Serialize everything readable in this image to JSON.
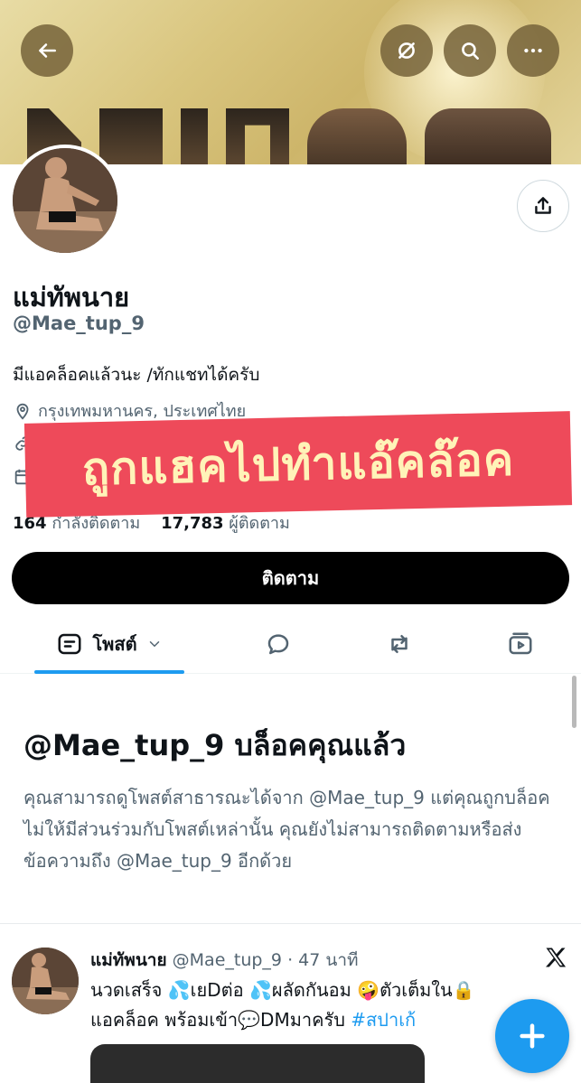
{
  "header": {
    "back_icon": "arrow-left-icon",
    "translate_icon": "no-translate-icon",
    "search_icon": "search-icon",
    "more_icon": "more-horizontal-icon"
  },
  "profile": {
    "display_name": "แม่ทัพนาย",
    "handle": "@Mae_tup_9",
    "bio": "มีแอคล็อคแล้วนะ /ทักแชทได้ครับ",
    "location": "กรุงเทพมหานคร, ประเทศไทย",
    "following_count": "164",
    "following_label": "กำลังติดตาม",
    "followers_count": "17,783",
    "followers_label": "ผู้ติดตาม",
    "follow_button": "ติดตาม"
  },
  "overlay": {
    "hacked_text": "ถูกแฮคไปทำแอ๊คล๊อค"
  },
  "tabs": {
    "posts_label": "โพสต์"
  },
  "blocked": {
    "title": "@Mae_tup_9 บล็อคคุณแล้ว",
    "description": "คุณสามารถดูโพสต์สาธารณะได้จาก @Mae_tup_9 แต่คุณถูกบล็อคไม่ให้มีส่วนร่วมกับโพสต์เหล่านั้น คุณยังไม่สามารถติดตามหรือส่งข้อความถึง @Mae_tup_9 อีกด้วย"
  },
  "post": {
    "author": "แม่ทัพนาย",
    "handle": "@Mae_tup_9",
    "time": "· 47 นาที",
    "text_line1": "นวดเสร็จ 💦เยDต่อ 💦ผลัดกันอม 🤪ตัวเต็มใน🔒",
    "text_line2": "แอคล็อค พร้อมเข้า💬DMมาครับ ",
    "hashtag": "#สปาเก้"
  },
  "colors": {
    "accent": "#1d9bf0",
    "overlay_bg": "#ee4a5a",
    "overlay_text": "#fff3b8"
  }
}
